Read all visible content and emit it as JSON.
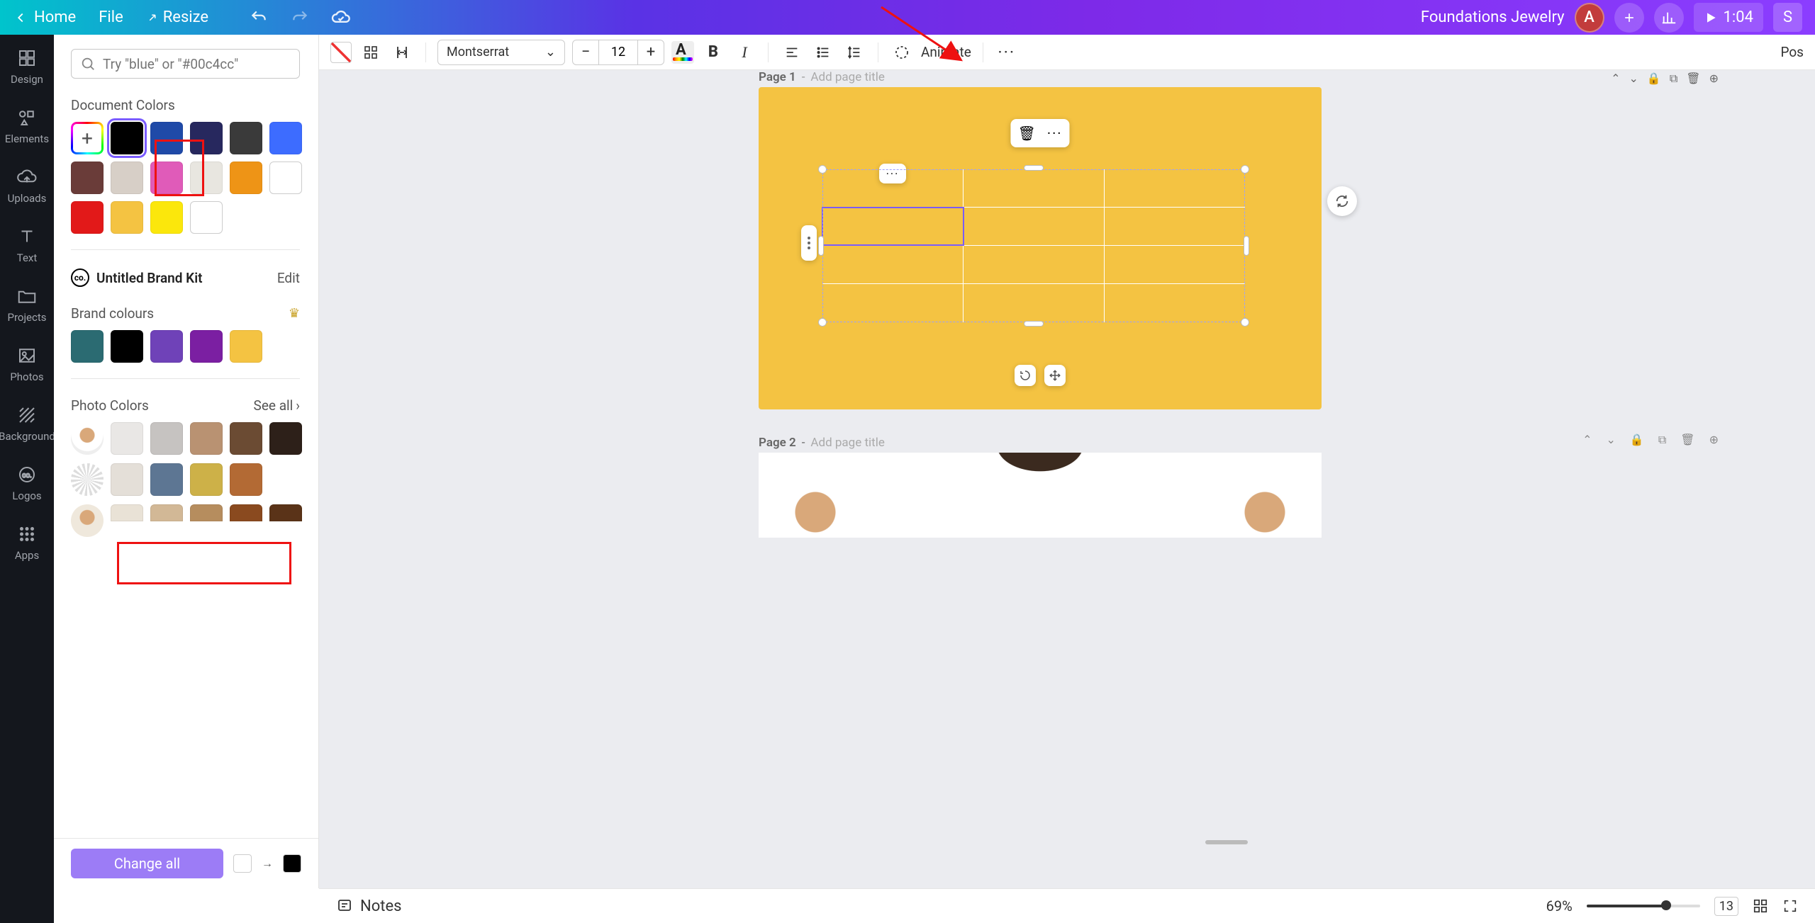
{
  "header": {
    "home": "Home",
    "file": "File",
    "resize": "Resize",
    "doc_title": "Foundations Jewelry",
    "avatar_letter": "A",
    "duration": "1:04",
    "share_label": "S"
  },
  "rail": {
    "design": "Design",
    "elements": "Elements",
    "uploads": "Uploads",
    "text": "Text",
    "projects": "Projects",
    "photos": "Photos",
    "background": "Background",
    "logos": "Logos",
    "apps": "Apps"
  },
  "panel": {
    "search_placeholder": "Try \"blue\" or \"#00c4cc\"",
    "doc_colors_label": "Document Colors",
    "brand_kit_title": "Untitled Brand Kit",
    "edit": "Edit",
    "brand_colours_label": "Brand colours",
    "photo_colors_label": "Photo Colors",
    "see_all": "See all",
    "change_all": "Change all",
    "doc_colors": [
      "#000000",
      "#1f4aa8",
      "#27285e",
      "#3a3a3a",
      "#3d6cff",
      "#6a3c39",
      "#d7cfc7",
      "#e05bb9",
      "#e8e6e0",
      "#ee9416",
      "#ffffff",
      "#e21919",
      "#f4c342",
      "#fbe70c",
      "#ffffff"
    ],
    "brand_colors": [
      "#2b6b72",
      "#000000",
      "#6f42b8",
      "#7b1fa2",
      "#f4c342"
    ],
    "photo_colors_1": [
      "#e9e7e5",
      "#c6c3c1",
      "#b99272",
      "#6b4b33",
      "#2d2019"
    ],
    "photo_colors_2": [
      "#e4dfd8",
      "#5d7693",
      "#cdb148",
      "#b36a34"
    ],
    "photo_colors_3": [
      "#e9e2d6",
      "#d2b896",
      "#b68d5e",
      "#8a4a1f",
      "#5a3318"
    ],
    "change_from": "#ffffff",
    "change_to": "#000000"
  },
  "toolbar": {
    "font": "Montserrat",
    "size": "12",
    "animate": "Animate",
    "position": "Pos"
  },
  "canvas": {
    "page1_label": "Page 1",
    "page2_label": "Page 2",
    "dash": "-",
    "page_title_ph": "Add page title"
  },
  "bottom": {
    "notes": "Notes",
    "zoom": "69%",
    "page_count": "13"
  }
}
